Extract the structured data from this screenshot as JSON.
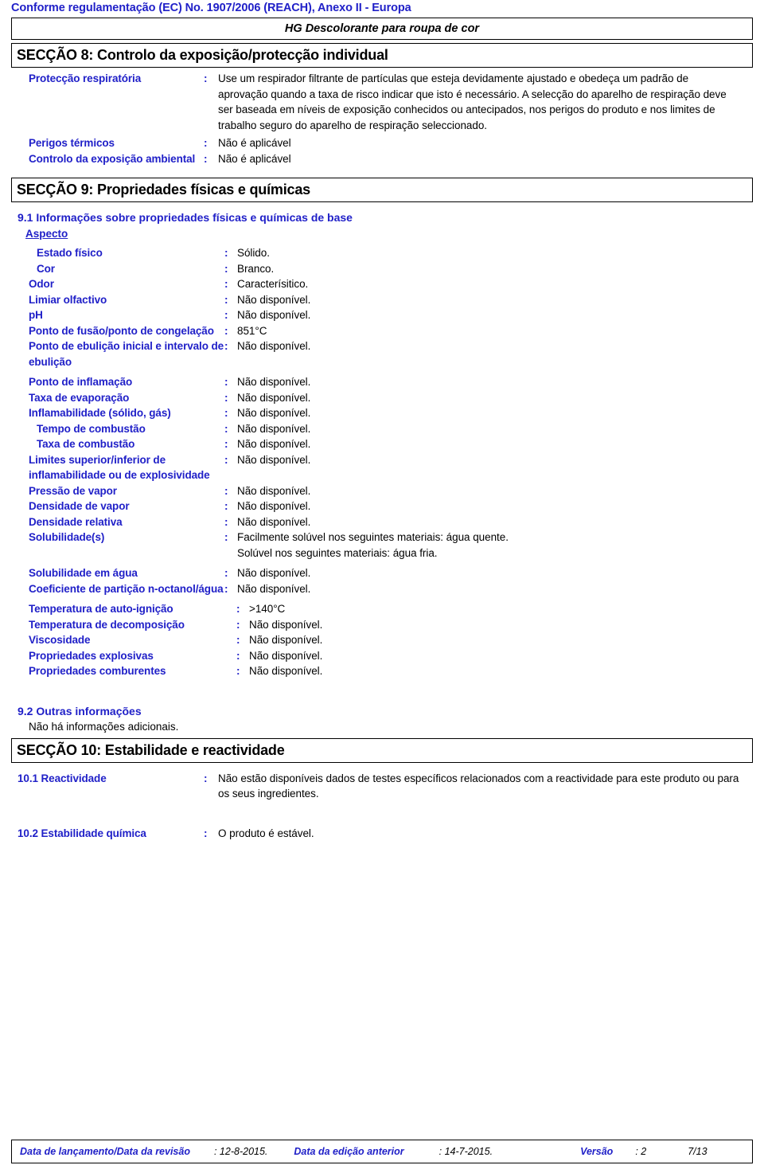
{
  "header": {
    "regulation_line": "Conforme regulamentação (EC) No. 1907/2006 (REACH), Anexo II - Europa",
    "product_name": "HG Descolorante para roupa de cor"
  },
  "section8": {
    "title": "SECÇÃO 8: Controlo da exposição/protecção individual",
    "rows": [
      {
        "label": "Protecção respiratória",
        "colon": ":",
        "value": "Use um respirador filtrante de partículas que esteja devidamente ajustado e obedeça um padrão de aprovação quando a taxa de risco indicar que isto é necessário. A selecção do aparelho de respiração deve ser baseada em níveis de exposição conhecidos ou antecipados, nos perigos do produto e nos limites de trabalho seguro do aparelho de respiração seleccionado."
      },
      {
        "label": "Perigos térmicos",
        "colon": ":",
        "value": "Não é aplicável"
      },
      {
        "label": "Controlo da exposição ambiental",
        "colon": ":",
        "value": "Não é aplicável"
      }
    ]
  },
  "section9": {
    "title": "SECÇÃO 9: Propriedades físicas e químicas",
    "subheading_91": "9.1 Informações sobre propriedades físicas e químicas de base",
    "aspecto_label": "Aspecto",
    "properties": [
      {
        "label": "Estado físico",
        "colon": ":",
        "value": "Sólido."
      },
      {
        "label": "Cor",
        "colon": ":",
        "value": "Branco."
      },
      {
        "label": "Odor",
        "colon": ":",
        "value": "Caracterísitico."
      },
      {
        "label": "Limiar olfactivo",
        "colon": ":",
        "value": "Não disponível."
      },
      {
        "label": "pH",
        "colon": ":",
        "value": "Não disponível."
      },
      {
        "label": "Ponto de fusão/ponto de congelação",
        "colon": ":",
        "value": "851°C"
      },
      {
        "label": "Ponto de ebulição inicial e intervalo de ebulição",
        "colon": ":",
        "value": "Não disponível."
      },
      {
        "label": "Ponto de inflamação",
        "colon": ":",
        "value": "Não disponível."
      },
      {
        "label": "Taxa de evaporação",
        "colon": ":",
        "value": "Não disponível."
      },
      {
        "label": "Inflamabilidade (sólido, gás)",
        "colon": ":",
        "value": "Não disponível."
      },
      {
        "label": "Tempo de combustão",
        "colon": ":",
        "value": "Não disponível."
      },
      {
        "label": "Taxa de combustão",
        "colon": ":",
        "value": "Não disponível."
      },
      {
        "label": "Limites superior/inferior de inflamabilidade ou de explosividade",
        "colon": ":",
        "value": "Não disponível."
      },
      {
        "label": "Pressão de vapor",
        "colon": ":",
        "value": "Não disponível."
      },
      {
        "label": "Densidade de vapor",
        "colon": ":",
        "value": "Não disponível."
      },
      {
        "label": "Densidade relativa",
        "colon": ":",
        "value": "Não disponível."
      },
      {
        "label": "Solubilidade(s)",
        "colon": ":",
        "value_line1": "Facilmente solúvel nos seguintes materiais: água quente.",
        "value_line2": "Solúvel nos seguintes materiais: água fria."
      },
      {
        "label": "Solubilidade em água",
        "colon": ":",
        "value": "Não disponível."
      },
      {
        "label": "Coeficiente de partição n-octanol/água",
        "colon": ":",
        "value": "Não disponível."
      },
      {
        "label": "Temperatura de auto-ignição",
        "colon": ":",
        "value": ">140°C"
      },
      {
        "label": "Temperatura de decomposição",
        "colon": ":",
        "value": "Não disponível."
      },
      {
        "label": "Viscosidade",
        "colon": ":",
        "value": "Não disponível."
      },
      {
        "label": "Propriedades explosivas",
        "colon": ":",
        "value": "Não disponível."
      },
      {
        "label": "Propriedades comburentes",
        "colon": ":",
        "value": "Não disponível."
      }
    ],
    "subheading_92": "9.2 Outras informações",
    "note_92": "Não há informações adicionais."
  },
  "section10": {
    "title": "SECÇÃO 10: Estabilidade e reactividade",
    "rows": [
      {
        "label": "10.1 Reactividade",
        "colon": ":",
        "value": "Não estão disponíveis dados de testes específicos relacionados com a reactividade para este produto ou para os seus ingredientes."
      },
      {
        "label": "10.2 Estabilidade química",
        "colon": ":",
        "value": "O produto é estável."
      }
    ]
  },
  "footer": {
    "issue_label": "Data de lançamento/Data da revisão",
    "issue_colon_value": ": 12-8-2015.",
    "previous_label": "Data da edição anterior",
    "previous_colon_value": ": 14-7-2015.",
    "version_label": "Versão",
    "version_colon_value": ": 2",
    "page": "7/13"
  }
}
